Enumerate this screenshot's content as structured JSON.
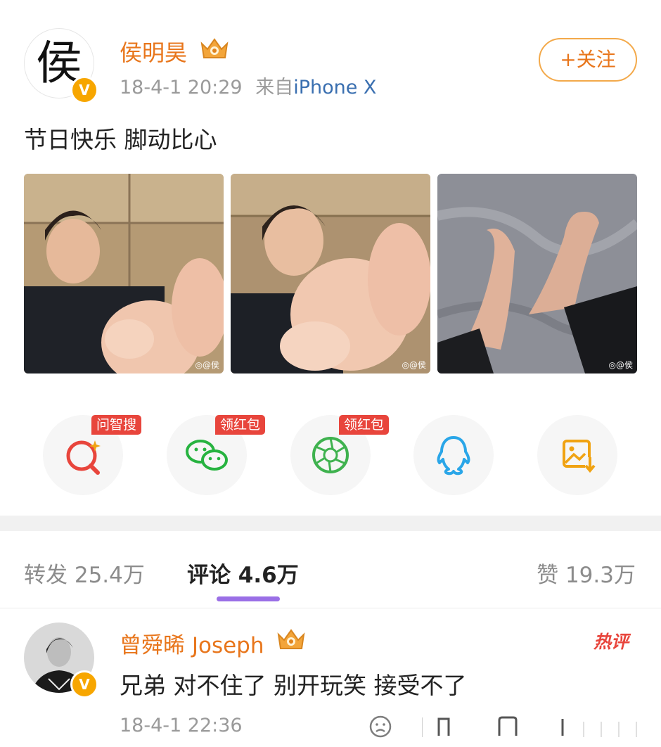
{
  "post": {
    "avatar_char": "侯",
    "author": "侯明昊",
    "verified_badge": "V",
    "time": "18-4-1 20:29",
    "source_prefix": "来自",
    "source": "iPhone X",
    "follow_label": "+关注",
    "text": "节日快乐 脚动比心",
    "photos": [
      {
        "subject": "selfie-feet-heart-1",
        "watermark": "◎@侯"
      },
      {
        "subject": "selfie-feet-heart-2",
        "watermark": "◎@侯"
      },
      {
        "subject": "feet-on-grey-sheet",
        "watermark": "◎@侯"
      }
    ]
  },
  "share": {
    "items": [
      {
        "icon": "search-sparkle-icon",
        "badge": "问智搜",
        "color": "#e8453c"
      },
      {
        "icon": "wechat-icon",
        "badge": "领红包",
        "color": "#27b340"
      },
      {
        "icon": "moments-icon",
        "badge": "领红包",
        "color": "#3fb24f"
      },
      {
        "icon": "qq-icon",
        "badge": "",
        "color": "#2aa6e8"
      },
      {
        "icon": "save-image-icon",
        "badge": "",
        "color": "#f0a313"
      }
    ]
  },
  "tabs": {
    "repost": "转发 25.4万",
    "comments": "评论 4.6万",
    "likes": "赞 19.3万"
  },
  "comment": {
    "author": "曾舜晞 Joseph",
    "hot_tag": "热评",
    "text": "兄弟 对不住了 别开玩笑 接受不了",
    "time": "18-4-1 22:36"
  },
  "colors": {
    "author_orange": "#e8761c",
    "badge_red": "#e8453c",
    "tab_underline": "#9a6fe6",
    "link_blue": "#3a6fb0"
  }
}
